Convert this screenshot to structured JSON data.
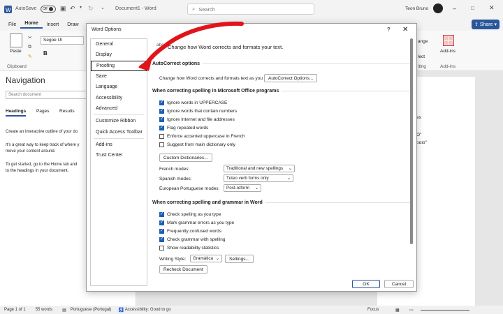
{
  "titlebar": {
    "autosave_label": "AutoSave",
    "autosave_state": "Off",
    "doc_title": "Document1 - Word",
    "search_placeholder": "Search",
    "user_name": "Teon Bruno"
  },
  "menu": {
    "items": [
      "File",
      "Home",
      "Insert",
      "Draw"
    ],
    "active": "Home",
    "share_label": "Share"
  },
  "ribbon": {
    "paste_label": "Paste",
    "font_name": "Segoe UI",
    "clipboard_label": "Clipboard",
    "right_fragments": [
      "ange",
      "lect",
      "iting"
    ],
    "addins_label": "Add-ins",
    "addins_group": "Add-ins"
  },
  "nav": {
    "title": "Navigation",
    "search_placeholder": "Search document",
    "tabs": [
      "Headings",
      "Pages",
      "Results"
    ],
    "text1": "Create an interactive outline of your do",
    "text2a": "It's a great way to keep track of where y",
    "text2b": "move your content around.",
    "text3a": "To get started, go to the Home tab and",
    "text3b": "to the headings in your document."
  },
  "doc_fragments": [
    "es",
    "Ο\"",
    "ραιο\""
  ],
  "statusbar": {
    "page": "Page 1 of 1",
    "words": "55 words",
    "language": "Portuguese (Portugal)",
    "accessibility": "Accessibility: Good to go",
    "focus": "Focus"
  },
  "dialog": {
    "title": "Word Options",
    "help": "?",
    "close": "✕",
    "categories": [
      "General",
      "Display",
      "Proofing",
      "Save",
      "Language",
      "Accessibility",
      "Advanced",
      "Customize Ribbon",
      "Quick Access Toolbar",
      "Add-ins",
      "Trust Center"
    ],
    "selected_category": "Proofing",
    "header_text": "Change how Word corrects and formats your text.",
    "header_icon_text": "abc",
    "autocorrect": {
      "heading": "AutoCorrect options",
      "label": "Change how Word corrects and formats text as you type:",
      "button": "AutoCorrect Options..."
    },
    "office": {
      "heading": "When correcting spelling in Microsoft Office programs",
      "options": [
        {
          "label": "Ignore words in UPPERCASE",
          "checked": true
        },
        {
          "label": "Ignore words that contain numbers",
          "checked": true
        },
        {
          "label": "Ignore Internet and file addresses",
          "checked": true
        },
        {
          "label": "Flag repeated words",
          "checked": true
        },
        {
          "label": "Enforce accented uppercase in French",
          "checked": false
        },
        {
          "label": "Suggest from main dictionary only",
          "checked": false
        }
      ],
      "custom_dict_button": "Custom Dictionaries...",
      "french_label": "French modes:",
      "french_value": "Traditional and new spellings",
      "spanish_label": "Spanish modes:",
      "spanish_value": "Tuteo verb forms only",
      "portuguese_label": "European Portuguese modes:",
      "portuguese_value": "Post-reform"
    },
    "word": {
      "heading": "When correcting spelling and grammar in Word",
      "options": [
        {
          "label": "Check spelling as you type",
          "checked": true
        },
        {
          "label": "Mark grammar errors as you type",
          "checked": true
        },
        {
          "label": "Frequently confused words",
          "checked": true
        },
        {
          "label": "Check grammar with spelling",
          "checked": true
        },
        {
          "label": "Show readability statistics",
          "checked": false
        }
      ],
      "writing_style_label": "Writing Style:",
      "writing_style_value": "Gramática",
      "settings_button": "Settings...",
      "recheck_button": "Recheck Document"
    },
    "ok": "OK",
    "cancel": "Cancel"
  },
  "colors": {
    "accent": "#2b579a",
    "checkbox": "#1a5fb4",
    "arrow": "#e0141b"
  }
}
